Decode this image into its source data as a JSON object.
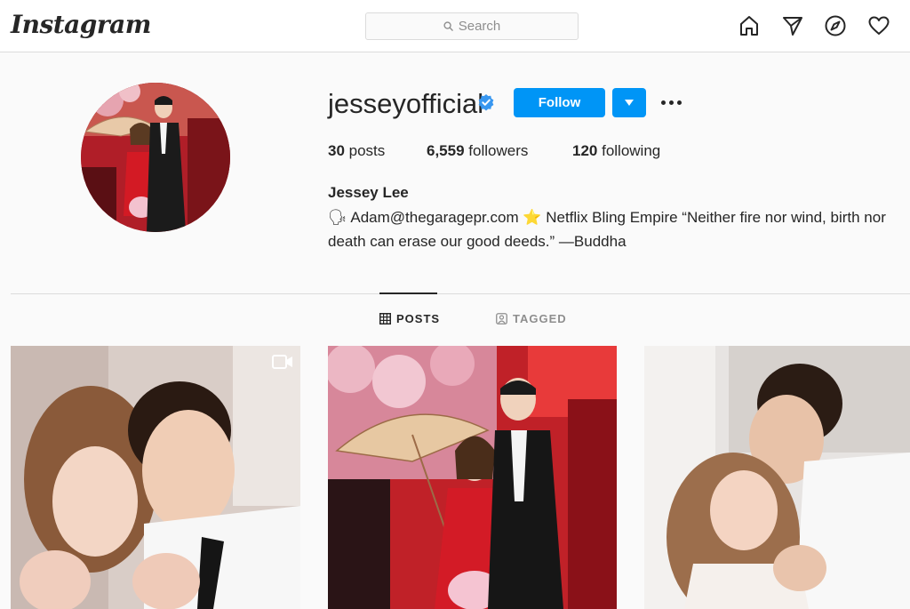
{
  "app": {
    "logo_text": "Instagram"
  },
  "search": {
    "placeholder": "Search"
  },
  "nav": {
    "icons": [
      "home-icon",
      "direct-message-icon",
      "explore-compass-icon",
      "activity-heart-icon"
    ]
  },
  "profile": {
    "username": "jesseyofficial",
    "verified": true,
    "follow_label": "Follow",
    "posts_count": "30",
    "posts_label": " posts",
    "followers_count": "6,559",
    "followers_label": " followers",
    "following_count": "120",
    "following_label": " following",
    "full_name": "Jessey Lee",
    "bio_line1": "🗣 Adam@thegaragepr.com ⭐ Netflix Bling Empire “Neither fire nor wind, birth nor",
    "bio_line2": "death can erase our good deeds.” —Buddha"
  },
  "tabs": [
    {
      "label": "POSTS",
      "active": true,
      "icon": "grid-icon"
    },
    {
      "label": "TAGGED",
      "active": false,
      "icon": "tagged-user-icon"
    }
  ],
  "colors": {
    "accent": "#0095f6",
    "text": "#262626",
    "muted": "#8e8e8e",
    "border": "#dbdbdb",
    "background": "#fafafa"
  }
}
